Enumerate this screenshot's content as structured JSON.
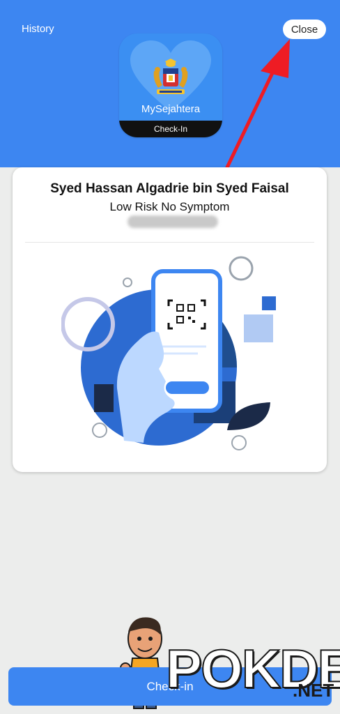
{
  "header": {
    "history_label": "History",
    "close_label": "Close"
  },
  "app_icon": {
    "name": "MySejahtera",
    "strip_label": "Check-In"
  },
  "card": {
    "user_name": "Syed Hassan Algadrie bin Syed Faisal",
    "risk_status": "Low Risk No Symptom"
  },
  "footer": {
    "button_label": "Check-in"
  },
  "watermark": {
    "brand_main": "POKDE",
    "brand_suffix": ".NET"
  },
  "colors": {
    "primary_blue": "#3d86f1",
    "background": "#ecedec",
    "card": "#ffffff",
    "arrow_red": "#ee1c24",
    "illustration_dark": "#1f4e8f",
    "illustration_light": "#bcd8ff"
  },
  "icons": [
    "heart-icon",
    "coat-of-arms-icon",
    "qr-code-icon",
    "red-arrow-annotation"
  ]
}
